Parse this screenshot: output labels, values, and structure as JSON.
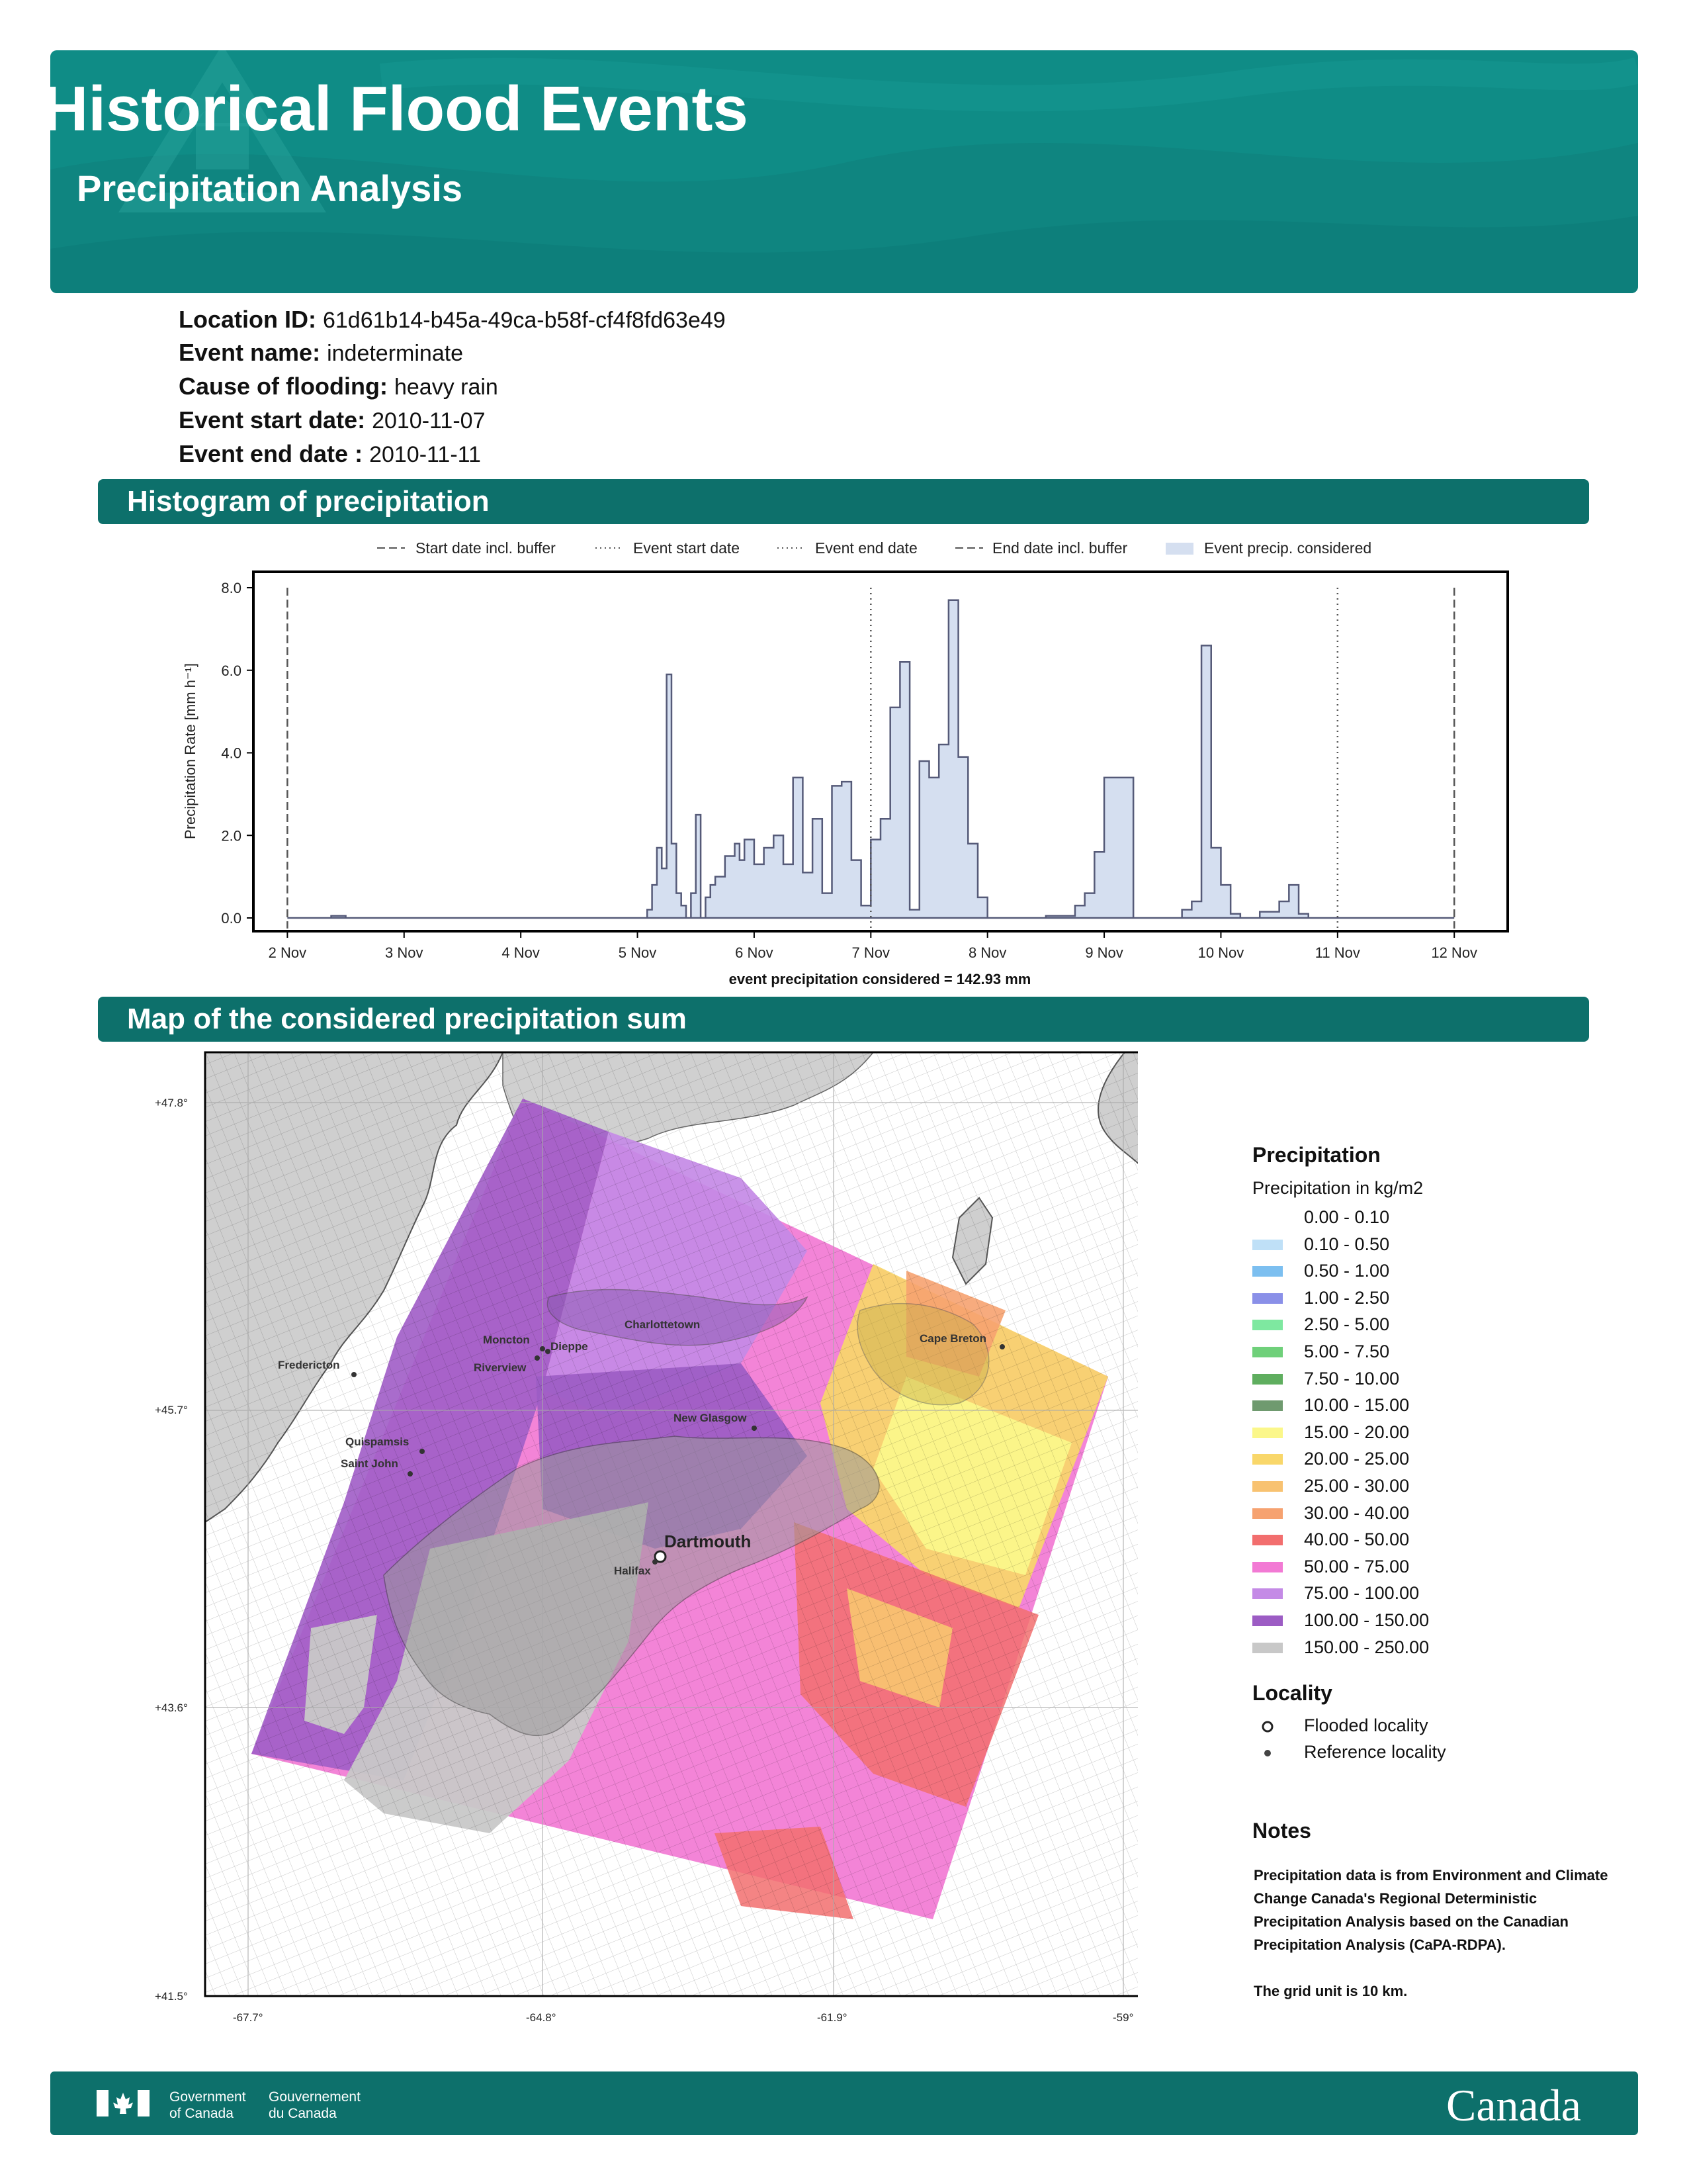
{
  "header": {
    "title": "Historical Flood Events",
    "subtitle": "Precipitation Analysis"
  },
  "info": [
    {
      "label": "Location ID:",
      "value": "61d61b14-b45a-49ca-b58f-cf4f8fd63e49"
    },
    {
      "label": "Event name:",
      "value": "indeterminate"
    },
    {
      "label": "Cause of flooding:",
      "value": "heavy rain"
    },
    {
      "label": "Event start date:",
      "value": "2010-11-07"
    },
    {
      "label": "Event end date :",
      "value": "2010-11-11"
    }
  ],
  "sections": {
    "histogram": "Histogram of precipitation",
    "map": "Map of the considered precipitation sum"
  },
  "chart_data": {
    "type": "area",
    "ylabel": "Precipitation Rate [mm h⁻¹]",
    "xlabel": "event precipitation considered = 142.93 mm",
    "ylim": [
      0,
      8
    ],
    "yticks": [
      "0.0",
      "2.0",
      "4.0",
      "6.0",
      "8.0"
    ],
    "xlim": [
      "2010-11-01T20:00",
      "2010-11-12T08:00"
    ],
    "xticks": [
      "2 Nov",
      "3 Nov",
      "4 Nov",
      "5 Nov",
      "6 Nov",
      "7 Nov",
      "8 Nov",
      "9 Nov",
      "10 Nov",
      "11 Nov",
      "12 Nov"
    ],
    "legend": [
      {
        "label": "Start date incl. buffer",
        "style": "dashed"
      },
      {
        "label": "Event start date",
        "style": "dotted"
      },
      {
        "label": "Event end date",
        "style": "dotted"
      },
      {
        "label": "End date incl. buffer",
        "style": "dashed"
      },
      {
        "label": "Event precip. considered",
        "style": "fill"
      }
    ],
    "vlines": [
      {
        "x": "2010-11-02T00:00",
        "style": "dashed"
      },
      {
        "x": "2010-11-07T00:00",
        "style": "dotted"
      },
      {
        "x": "2010-11-11T00:00",
        "style": "dotted"
      },
      {
        "x": "2010-11-12T00:00",
        "style": "dashed"
      }
    ],
    "colors": {
      "fill": "#d5dff0",
      "edge": "#555a78",
      "axis": "#000000"
    },
    "series": [
      {
        "x": [
          "2010-11-02T00:00",
          "2010-11-02T06:00",
          "2010-11-02T09:00",
          "2010-11-02T12:00",
          "2010-11-02T18:00",
          "2010-11-03T00:00",
          "2010-11-04T00:00",
          "2010-11-05T00:00",
          "2010-11-05T02:00",
          "2010-11-05T03:00",
          "2010-11-05T04:00",
          "2010-11-05T05:00",
          "2010-11-05T06:00",
          "2010-11-05T07:00",
          "2010-11-05T08:00",
          "2010-11-05T09:00",
          "2010-11-05T10:00",
          "2010-11-05T11:00",
          "2010-11-05T12:00",
          "2010-11-05T13:00",
          "2010-11-05T14:00",
          "2010-11-05T15:00",
          "2010-11-05T16:00",
          "2010-11-05T18:00",
          "2010-11-05T20:00",
          "2010-11-05T21:00",
          "2010-11-05T22:00",
          "2010-11-06T00:00",
          "2010-11-06T02:00",
          "2010-11-06T04:00",
          "2010-11-06T06:00",
          "2010-11-06T08:00",
          "2010-11-06T10:00",
          "2010-11-06T12:00",
          "2010-11-06T14:00",
          "2010-11-06T16:00",
          "2010-11-06T18:00",
          "2010-11-06T20:00",
          "2010-11-06T22:00",
          "2010-11-07T00:00",
          "2010-11-07T02:00",
          "2010-11-07T04:00",
          "2010-11-07T06:00",
          "2010-11-07T08:00",
          "2010-11-07T10:00",
          "2010-11-07T12:00",
          "2010-11-07T14:00",
          "2010-11-07T16:00",
          "2010-11-07T18:00",
          "2010-11-07T20:00",
          "2010-11-07T22:00",
          "2010-11-08T00:00",
          "2010-11-08T06:00",
          "2010-11-08T12:00",
          "2010-11-08T18:00",
          "2010-11-08T20:00",
          "2010-11-08T22:00",
          "2010-11-09T00:00",
          "2010-11-09T06:00",
          "2010-11-09T12:00",
          "2010-11-09T16:00",
          "2010-11-09T18:00",
          "2010-11-09T20:00",
          "2010-11-09T22:00",
          "2010-11-10T00:00",
          "2010-11-10T02:00",
          "2010-11-10T04:00",
          "2010-11-10T08:00",
          "2010-11-10T12:00",
          "2010-11-10T14:00",
          "2010-11-10T16:00",
          "2010-11-10T18:00",
          "2010-11-11T00:00",
          "2010-11-12T00:00"
        ],
        "values": [
          0.0,
          0.0,
          0.05,
          0.0,
          0.0,
          0.0,
          0.0,
          0.0,
          0.2,
          0.8,
          1.7,
          1.2,
          5.9,
          1.8,
          0.6,
          0.3,
          0.0,
          0.6,
          2.5,
          0.0,
          0.5,
          0.8,
          1.0,
          1.5,
          1.8,
          1.4,
          1.9,
          1.3,
          1.7,
          2.0,
          1.3,
          3.4,
          1.1,
          2.4,
          0.6,
          3.2,
          3.3,
          1.4,
          0.3,
          1.9,
          2.4,
          5.1,
          6.2,
          0.2,
          3.8,
          3.4,
          4.2,
          7.7,
          3.9,
          1.8,
          0.5,
          0.0,
          0.0,
          0.05,
          0.3,
          0.6,
          1.6,
          3.4,
          0.0,
          0.0,
          0.2,
          0.4,
          6.6,
          1.7,
          0.8,
          0.1,
          0.0,
          0.15,
          0.4,
          0.8,
          0.1,
          0.0,
          0.0,
          0.0
        ]
      }
    ]
  },
  "map": {
    "lat_labels": [
      "+47.8°",
      "+45.7°",
      "+43.6°",
      "+41.5°"
    ],
    "lon_labels": [
      "-67.7°",
      "-64.8°",
      "-61.9°",
      "-59°"
    ],
    "places": [
      {
        "name": "Moncton"
      },
      {
        "name": "Dieppe"
      },
      {
        "name": "Riverview"
      },
      {
        "name": "Charlottetown"
      },
      {
        "name": "Fredericton"
      },
      {
        "name": "Quispamsis"
      },
      {
        "name": "Saint John"
      },
      {
        "name": "New Glasgow"
      },
      {
        "name": "Cape Breton"
      },
      {
        "name": "Dartmouth"
      },
      {
        "name": "Halifax"
      }
    ]
  },
  "legend": {
    "precip_title": "Precipitation",
    "precip_sub": "Precipitation in kg/m2",
    "classes": [
      {
        "label": "0.00 - 0.10",
        "color": "#ffffff"
      },
      {
        "label": "0.10 - 0.50",
        "color": "#bfe0f7"
      },
      {
        "label": "0.50 - 1.00",
        "color": "#7cbff0"
      },
      {
        "label": "1.00 - 2.50",
        "color": "#8a90e8"
      },
      {
        "label": "2.50 - 5.00",
        "color": "#7ee8a0"
      },
      {
        "label": "5.00 - 7.50",
        "color": "#6fd07a"
      },
      {
        "label": "7.50 - 10.00",
        "color": "#5fae5f"
      },
      {
        "label": "10.00 - 15.00",
        "color": "#6f9a6f"
      },
      {
        "label": "15.00 - 20.00",
        "color": "#fbf78a"
      },
      {
        "label": "20.00 - 25.00",
        "color": "#f9d76a"
      },
      {
        "label": "25.00 - 30.00",
        "color": "#f8c271"
      },
      {
        "label": "30.00 - 40.00",
        "color": "#f6a270"
      },
      {
        "label": "40.00 - 50.00",
        "color": "#f26e6e"
      },
      {
        "label": "50.00 - 75.00",
        "color": "#f27ad4"
      },
      {
        "label": "75.00 - 100.00",
        "color": "#c48ae6"
      },
      {
        "label": "100.00 - 150.00",
        "color": "#9c5cc4"
      },
      {
        "label": "150.00 - 250.00",
        "color": "#c8c8c8"
      }
    ],
    "locality_title": "Locality",
    "flooded": "Flooded locality",
    "reference": "Reference locality"
  },
  "notes": {
    "title": "Notes",
    "text1": "Precipitation data is from Environment and Climate Change Canada's Regional Deterministic Precipitation Analysis based on the Canadian Precipitation Analysis (CaPA-RDPA).",
    "text2": "The grid unit is 10 km."
  },
  "footer": {
    "gov_en_1": "Government",
    "gov_en_2": "of Canada",
    "gov_fr_1": "Gouvernement",
    "gov_fr_2": "du Canada",
    "wordmark": "Canada"
  }
}
